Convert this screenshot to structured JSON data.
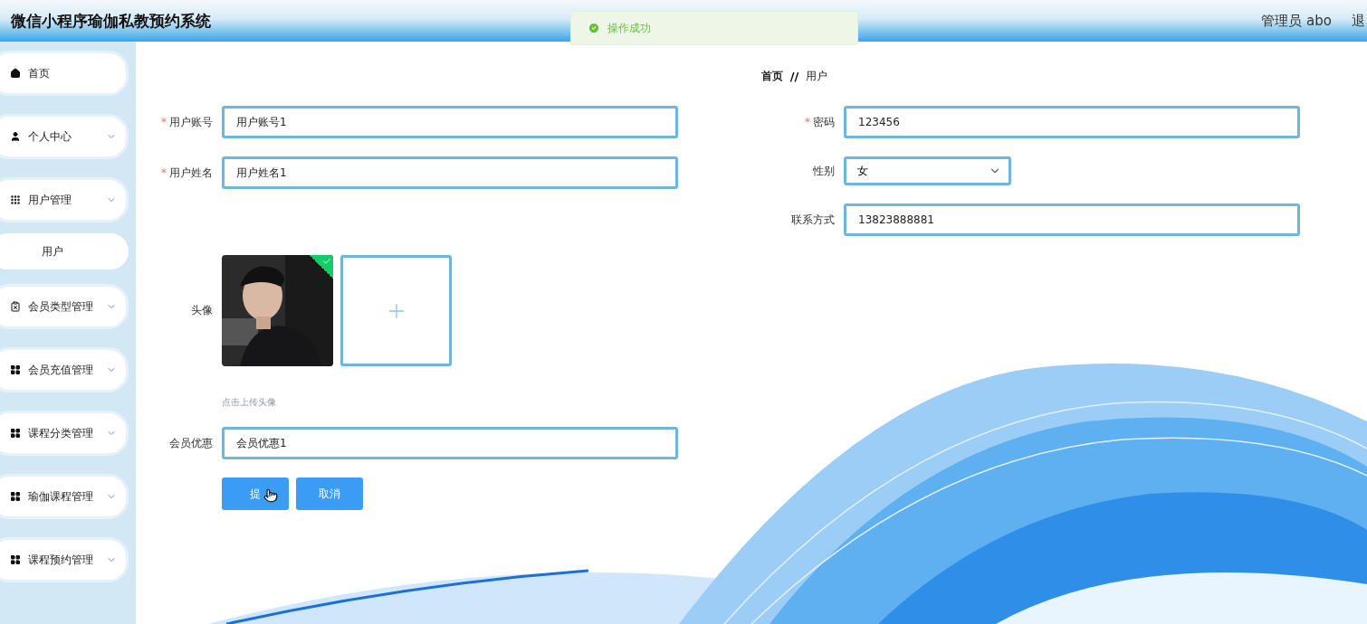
{
  "header": {
    "title": "微信小程序瑜伽私教预约系统",
    "user": "管理员 abo",
    "exit": "退"
  },
  "toast": {
    "message": "操作成功"
  },
  "breadcrumb": {
    "items": [
      "首页",
      "用户"
    ],
    "separator": "//"
  },
  "sidebar": {
    "items": [
      {
        "label": "首页"
      },
      {
        "label": "个人中心"
      },
      {
        "label": "用户管理",
        "children": [
          {
            "label": "用户"
          }
        ]
      },
      {
        "label": "会员类型管理"
      },
      {
        "label": "会员充值管理"
      },
      {
        "label": "课程分类管理"
      },
      {
        "label": "瑜伽课程管理"
      },
      {
        "label": "课程预约管理"
      }
    ]
  },
  "form": {
    "left": [
      {
        "kind": "text",
        "label": "用户账号",
        "mark": "*",
        "value": "用户账号1"
      },
      {
        "kind": "text",
        "label": "用户姓名",
        "mark": "*",
        "value": "用户姓名1"
      },
      {
        "kind": "upload",
        "label": "头像",
        "hint": "点击上传头像"
      },
      {
        "kind": "text",
        "label": "会员优惠",
        "value": "会员优惠1"
      }
    ],
    "right": [
      {
        "kind": "text",
        "label": "密码",
        "mark": "*",
        "value": "123456"
      },
      {
        "kind": "select",
        "label": "性别",
        "value": "女"
      },
      {
        "kind": "text",
        "label": "联系方式",
        "value": "13823888881"
      }
    ],
    "buttons": [
      "提",
      "取消"
    ]
  }
}
